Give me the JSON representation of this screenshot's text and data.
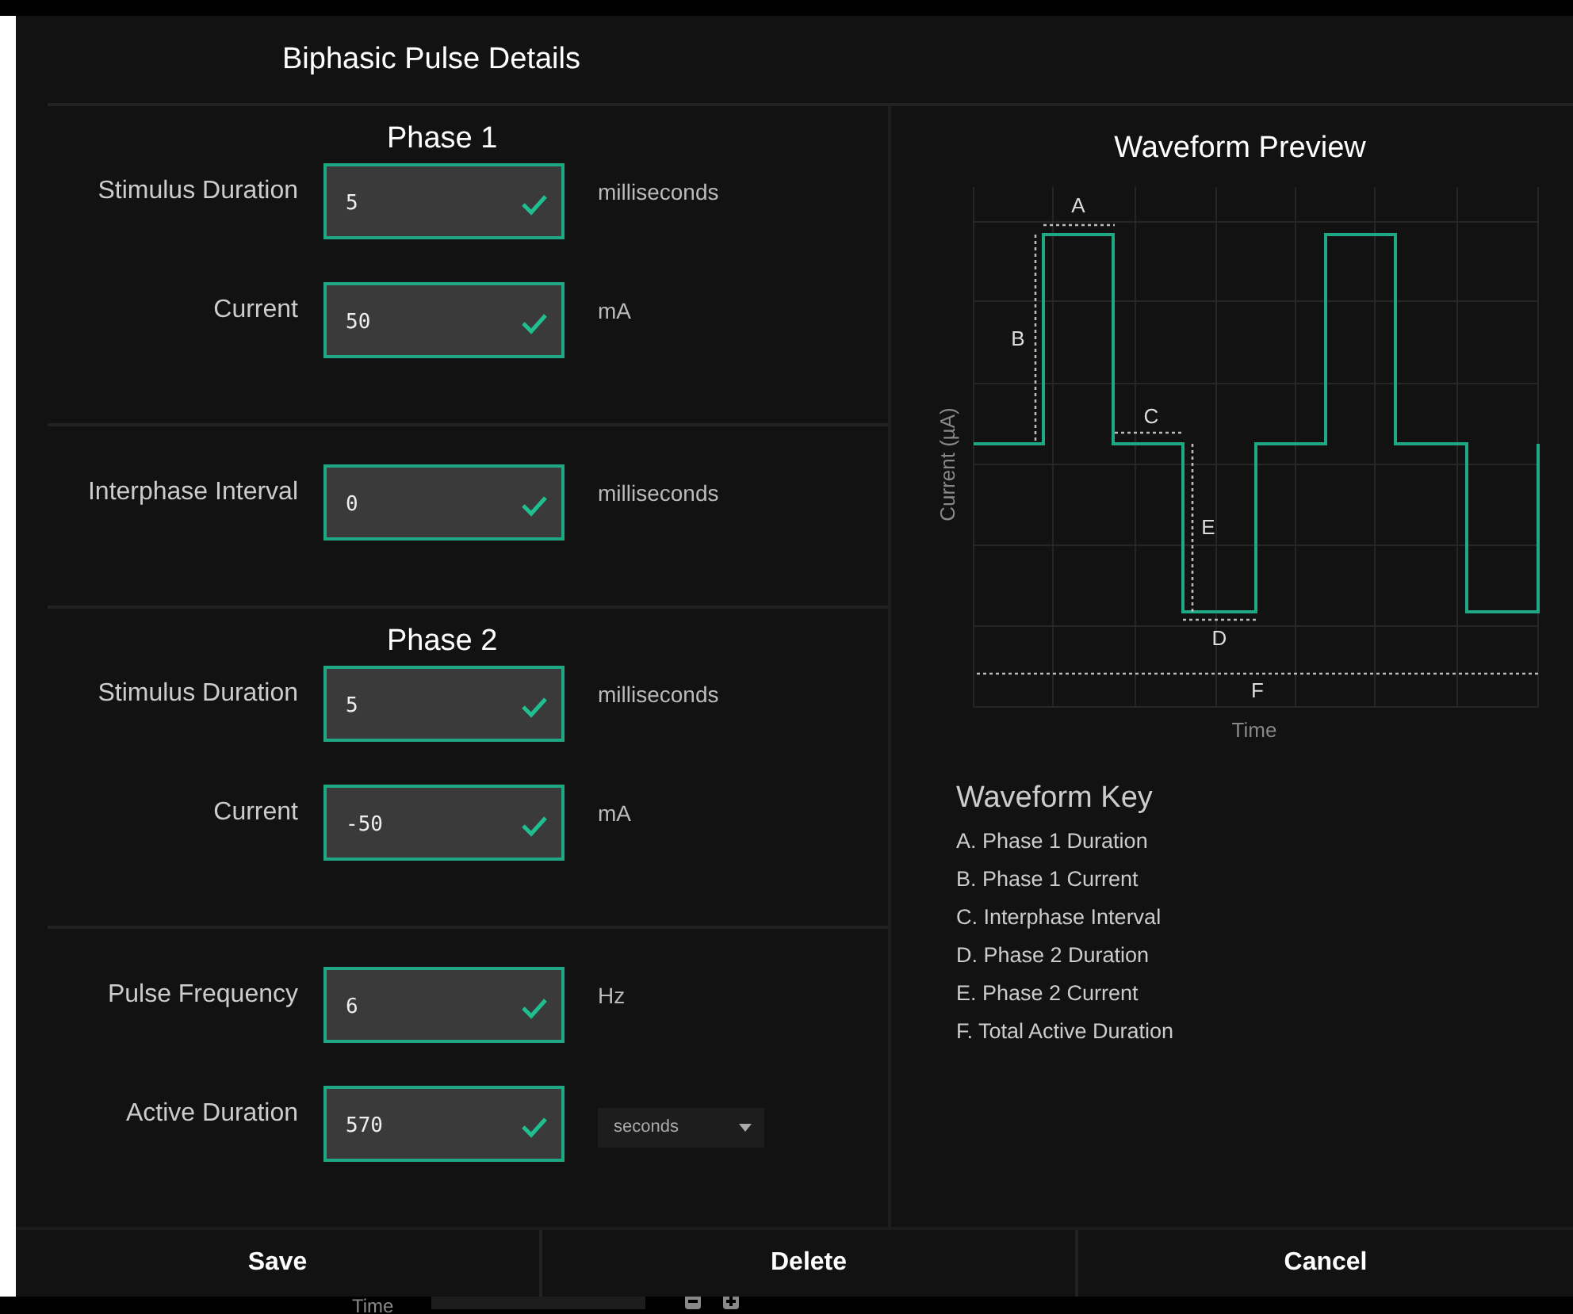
{
  "window": {
    "title": "Biphasic Pulse Details"
  },
  "sections": [
    {
      "title": "Phase 1",
      "fields": [
        {
          "label": "Stimulus Duration",
          "value": "5",
          "valid": true,
          "kind": "text",
          "unit": "milliseconds"
        },
        {
          "label": "Current",
          "value": "50",
          "valid": true,
          "kind": "text",
          "unit": "mA"
        }
      ]
    },
    {
      "fields": [
        {
          "label": "Interphase Interval",
          "value": "0",
          "valid": true,
          "kind": "text",
          "unit": "milliseconds"
        }
      ]
    },
    {
      "title": "Phase 2",
      "fields": [
        {
          "label": "Stimulus Duration",
          "value": "5",
          "valid": true,
          "kind": "text",
          "unit": "milliseconds"
        },
        {
          "label": "Current",
          "value": "-50",
          "valid": true,
          "kind": "text",
          "unit": "mA"
        }
      ]
    },
    {
      "fields": [
        {
          "label": "Pulse Frequency",
          "value": "6",
          "valid": true,
          "kind": "text",
          "unit": "Hz"
        },
        {
          "label": "Active Duration",
          "value": "570",
          "valid": true,
          "kind": "select",
          "unit": "seconds"
        }
      ]
    }
  ],
  "preview": {
    "title": "Waveform Preview",
    "y_axis_label": "Current (µA)",
    "x_axis_label": "Time",
    "markers": [
      "A",
      "B",
      "C",
      "D",
      "E",
      "F"
    ]
  },
  "key": {
    "title": "Waveform Key",
    "items": [
      "A. Phase 1 Duration",
      "B. Phase 1 Current",
      "C. Interphase Interval",
      "D. Phase 2 Duration",
      "E. Phase 2 Current",
      "F. Total Active Duration"
    ]
  },
  "buttons": [
    "Save",
    "Delete",
    "Cancel"
  ],
  "background": {
    "label": "Time"
  }
}
